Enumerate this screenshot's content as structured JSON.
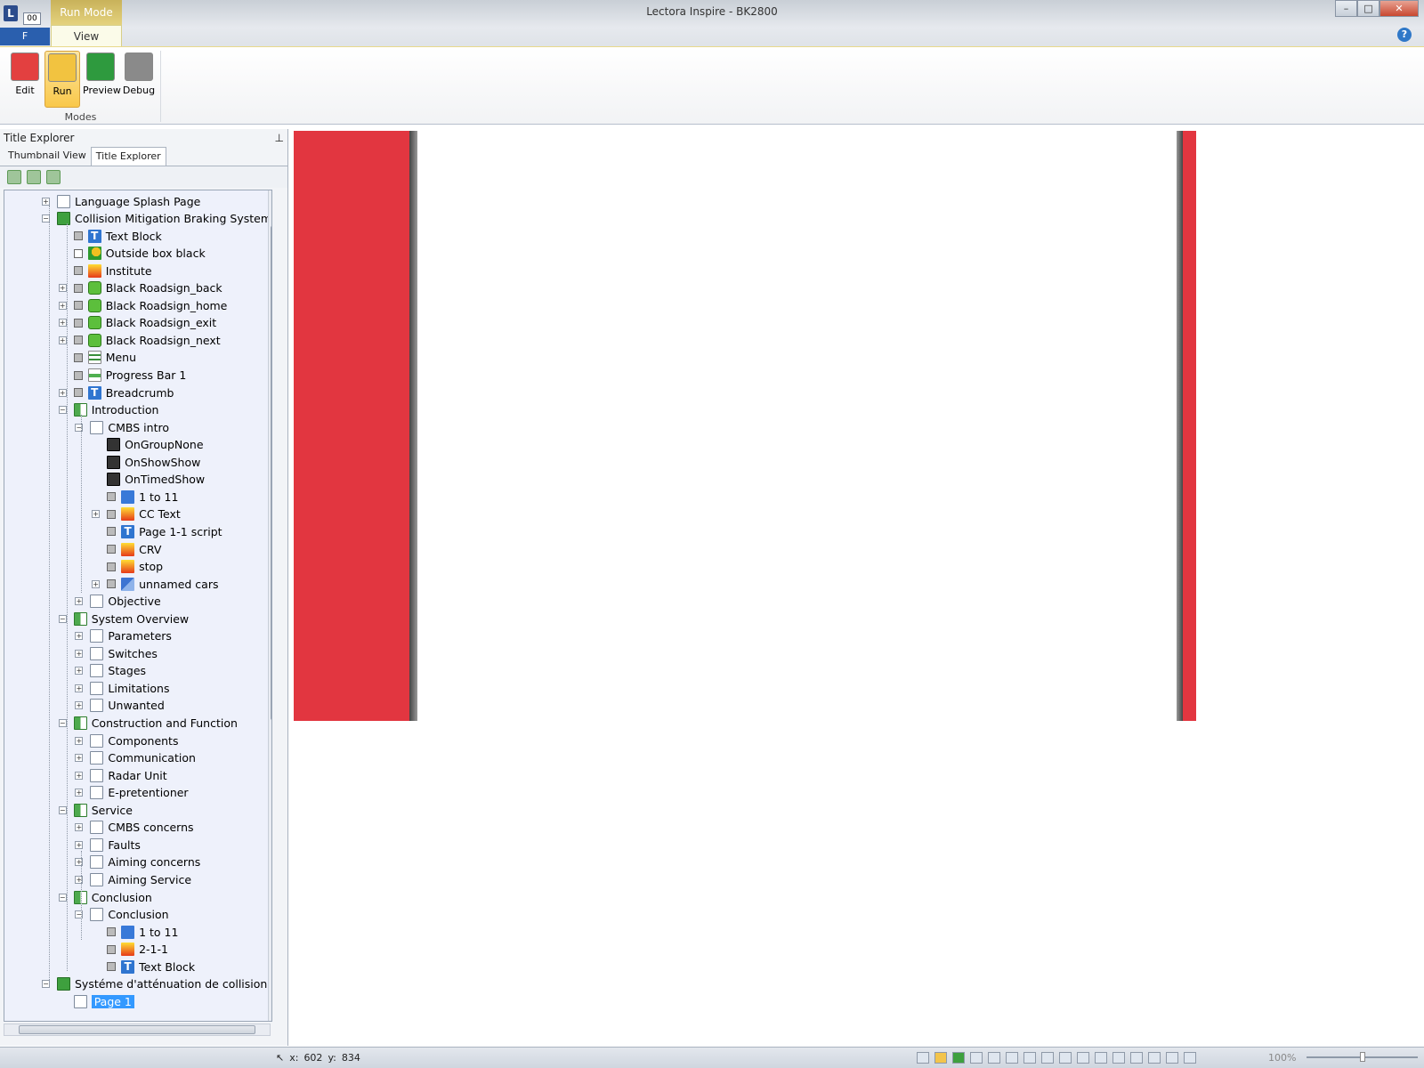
{
  "window": {
    "title": "Lectora Inspire - BK2800",
    "quick_access_label": "00",
    "file_tab": "F",
    "logo": "L",
    "minimize": "–",
    "maximize": "□",
    "close": "✕",
    "help": "?"
  },
  "ribbon": {
    "context_tab": "Run Mode",
    "active_tab": "View",
    "buttons": [
      {
        "label": "Edit",
        "icon": "edit-mode-icon",
        "color": "#e34040"
      },
      {
        "label": "Run",
        "icon": "run-mode-icon",
        "color": "#f2c340",
        "active": true
      },
      {
        "label": "Preview",
        "icon": "preview-mode-icon",
        "color": "#2e9a3e"
      },
      {
        "label": "Debug",
        "icon": "debug-mode-icon",
        "color": "#8a8a8a"
      }
    ],
    "group_label": "Modes"
  },
  "explorer": {
    "panel_title": "Title Explorer",
    "pin": "⊥",
    "tabs": [
      "Thumbnail View",
      "Title Explorer"
    ],
    "active_tab": "Title Explorer",
    "tree": [
      {
        "label": "Language Splash Page",
        "icon": "page",
        "expand": "+"
      },
      {
        "label": "Collision Mitigation Braking System",
        "icon": "book",
        "expand": "-"
      },
      {
        "label": "Text Block",
        "icon": "text",
        "check": true
      },
      {
        "label": "Outside box black",
        "icon": "shape",
        "check": true,
        "check_empty": true
      },
      {
        "label": "Institute",
        "icon": "image",
        "check": true
      },
      {
        "label": "Black Roadsign_back",
        "icon": "button",
        "check": true,
        "expand": "+"
      },
      {
        "label": "Black Roadsign_home",
        "icon": "button",
        "check": true,
        "expand": "+"
      },
      {
        "label": "Black Roadsign_exit",
        "icon": "button",
        "check": true,
        "expand": "+"
      },
      {
        "label": "Black Roadsign_next",
        "icon": "button",
        "check": true,
        "expand": "+"
      },
      {
        "label": "Menu",
        "icon": "menu",
        "check": true
      },
      {
        "label": "Progress Bar 1",
        "icon": "progress",
        "check": true
      },
      {
        "label": "Breadcrumb",
        "icon": "text",
        "check": true,
        "expand": "+"
      },
      {
        "label": "Introduction",
        "icon": "chapter",
        "expand": "-"
      },
      {
        "label": "CMBS intro",
        "icon": "page",
        "expand": "-"
      },
      {
        "label": "OnGroupNone",
        "icon": "action"
      },
      {
        "label": "OnShowShow",
        "icon": "action"
      },
      {
        "label": "OnTimedShow",
        "icon": "action"
      },
      {
        "label": "1 to 11",
        "icon": "audio",
        "check": true
      },
      {
        "label": "CC Text",
        "icon": "image",
        "check": true,
        "expand": "+"
      },
      {
        "label": "Page 1-1 script",
        "icon": "text",
        "check": true
      },
      {
        "label": "CRV",
        "icon": "image",
        "check": true
      },
      {
        "label": "stop",
        "icon": "image",
        "check": true
      },
      {
        "label": "unnamed cars",
        "icon": "group",
        "check": true,
        "expand": "+"
      },
      {
        "label": "Objective",
        "icon": "page",
        "expand": "+"
      },
      {
        "label": "System Overview",
        "icon": "chapter",
        "expand": "-"
      },
      {
        "label": "Parameters",
        "icon": "page",
        "expand": "+"
      },
      {
        "label": "Switches",
        "icon": "page",
        "expand": "+"
      },
      {
        "label": "Stages",
        "icon": "page",
        "expand": "+"
      },
      {
        "label": "Limitations",
        "icon": "page",
        "expand": "+"
      },
      {
        "label": "Unwanted",
        "icon": "page",
        "expand": "+"
      },
      {
        "label": "Construction and Function",
        "icon": "chapter",
        "expand": "-"
      },
      {
        "label": "Components",
        "icon": "page",
        "expand": "+"
      },
      {
        "label": "Communication",
        "icon": "page",
        "expand": "+"
      },
      {
        "label": "Radar Unit",
        "icon": "page",
        "expand": "+"
      },
      {
        "label": "E-pretentioner",
        "icon": "page",
        "expand": "+"
      },
      {
        "label": "Service",
        "icon": "chapter",
        "expand": "-"
      },
      {
        "label": "CMBS concerns",
        "icon": "page",
        "expand": "+"
      },
      {
        "label": "Faults",
        "icon": "page",
        "expand": "+"
      },
      {
        "label": "Aiming concerns",
        "icon": "page",
        "expand": "+"
      },
      {
        "label": "Aiming Service",
        "icon": "page",
        "expand": "+"
      },
      {
        "label": "Conclusion",
        "icon": "chapter",
        "expand": "-"
      },
      {
        "label": "Conclusion",
        "icon": "page",
        "expand": "-"
      },
      {
        "label": "1 to 11",
        "icon": "audio",
        "check": true
      },
      {
        "label": "2-1-1",
        "icon": "image",
        "check": true
      },
      {
        "label": "Text Block",
        "icon": "text",
        "check": true
      },
      {
        "label": "Systéme d'atténuation de collision",
        "icon": "book",
        "expand": "-"
      },
      {
        "label": "Page 1",
        "icon": "page",
        "selected": true
      }
    ]
  },
  "canvas": {
    "accent": "#e23640"
  },
  "statusbar": {
    "x_label": "x:",
    "x_value": "602",
    "y_label": "y:",
    "y_value": "834",
    "zoom": "100%"
  }
}
